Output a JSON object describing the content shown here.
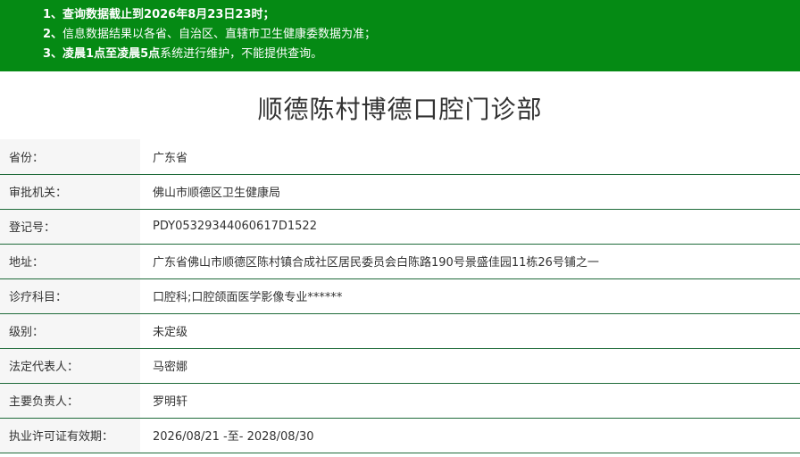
{
  "notice": {
    "line1_num": "1、",
    "line1_text": "查询数据截止到2026年8月23日23时；",
    "line2_num": "2、",
    "line2_text": "信息数据结果以各省、自治区、直辖市卫生健康委数据为准；",
    "line3_num": "3、",
    "line3_bold": "凌晨1点至凌晨5点",
    "line3_text": "系统进行维护，不能提供查询。"
  },
  "title": "顺德陈村博德口腔门诊部",
  "rows": [
    {
      "label": "省份：",
      "value": "广东省"
    },
    {
      "label": "审批机关：",
      "value": "佛山市顺德区卫生健康局"
    },
    {
      "label": "登记号：",
      "value": "PDY05329344060617D1522"
    },
    {
      "label": "地址：",
      "value": "广东省佛山市顺德区陈村镇合成社区居民委员会白陈路190号景盛佳园11栋26号铺之一"
    },
    {
      "label": "诊疗科目：",
      "value": "口腔科;口腔颌面医学影像专业******"
    },
    {
      "label": "级别：",
      "value": "未定级"
    },
    {
      "label": "法定代表人：",
      "value": "马密娜"
    },
    {
      "label": "主要负责人：",
      "value": "罗明轩"
    },
    {
      "label": "执业许可证有效期：",
      "value": "2026/08/21 -至- 2028/08/30"
    }
  ],
  "colors": {
    "notice_bg": "#058a14",
    "row_border": "#1f6b3a",
    "label_bg": "#f6f6f6"
  }
}
